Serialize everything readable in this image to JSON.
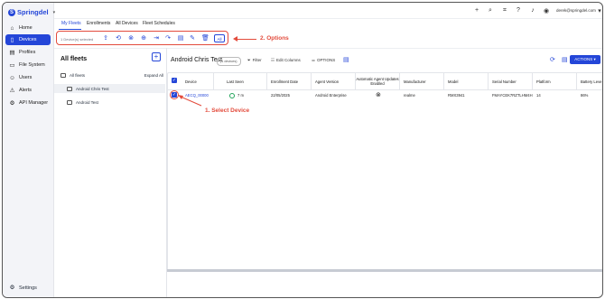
{
  "app": {
    "logo_text": "Springdel",
    "logo_badge": "S",
    "logo_caret": "▾"
  },
  "sidebar": {
    "items": [
      {
        "label": "Home",
        "icon": "home-icon",
        "glyph": "⌂",
        "active": false
      },
      {
        "label": "Devices",
        "icon": "device-icon",
        "glyph": "▯",
        "active": true
      },
      {
        "label": "Profiles",
        "icon": "profile-icon",
        "glyph": "▤",
        "active": false
      },
      {
        "label": "File System",
        "icon": "file-icon",
        "glyph": "▭",
        "active": false
      },
      {
        "label": "Users",
        "icon": "users-icon",
        "glyph": "☺",
        "active": false
      },
      {
        "label": "Alerts",
        "icon": "bell-icon",
        "glyph": "⚠",
        "active": false
      },
      {
        "label": "API Manager",
        "icon": "api-icon",
        "glyph": "⚙",
        "active": false
      }
    ],
    "settings_label": "Settings"
  },
  "topbar": {
    "email": "derek@springdel.com",
    "plus": "+",
    "search": "⌕",
    "grid": "⌗",
    "help": "?",
    "bell": "♪",
    "avatar": "◉",
    "caret": "▾"
  },
  "tabs": [
    {
      "label": "My Fleets",
      "active": true
    },
    {
      "label": "Enrollments",
      "active": false
    },
    {
      "label": "All Devices",
      "active": false
    },
    {
      "label": "Fleet Schedules",
      "active": false
    }
  ],
  "selection": {
    "text": "1 Device(s) selected",
    "tools": [
      "⇪",
      "⟲",
      "⊗",
      "⊕",
      "⇥",
      "↷",
      "▤",
      "✎",
      "🗑"
    ],
    "all_label": "All"
  },
  "annotations": {
    "options": "2. Options",
    "select_device": "1. Select Device"
  },
  "fleets": {
    "title": "All fleets",
    "add_label": "+",
    "expand_all": "Expand All",
    "all_label": "All fleets",
    "items": [
      "Android Chris Test",
      "Android Test"
    ]
  },
  "main": {
    "title": "Android Chris Test",
    "count": "(1 devices)",
    "filter": "Filter",
    "edit_columns": "Edit Columns",
    "options": "OPTIONS",
    "actions": "ACTIONS ▾",
    "refresh_glyph": "⟳",
    "doc_glyph": "▤"
  },
  "table": {
    "columns": [
      "Device",
      "Last Seen",
      "Enrollment Date",
      "Agent Version",
      "Automatic Agent Updates Enabled",
      "Manufacturer",
      "Model",
      "Serial Number",
      "Platform",
      "Battery Leve"
    ],
    "row": {
      "device": "AECQ_00000",
      "last_seen": "7 m",
      "enrollment_date": "22/05/2025",
      "agent_version": "Android Enterprise",
      "auto_updates": "⊗",
      "manufacturer": "realme",
      "model": "RMX3941",
      "serial": "FMAYCEK7RZTLHM4H",
      "platform": "14",
      "battery": "86%"
    }
  }
}
